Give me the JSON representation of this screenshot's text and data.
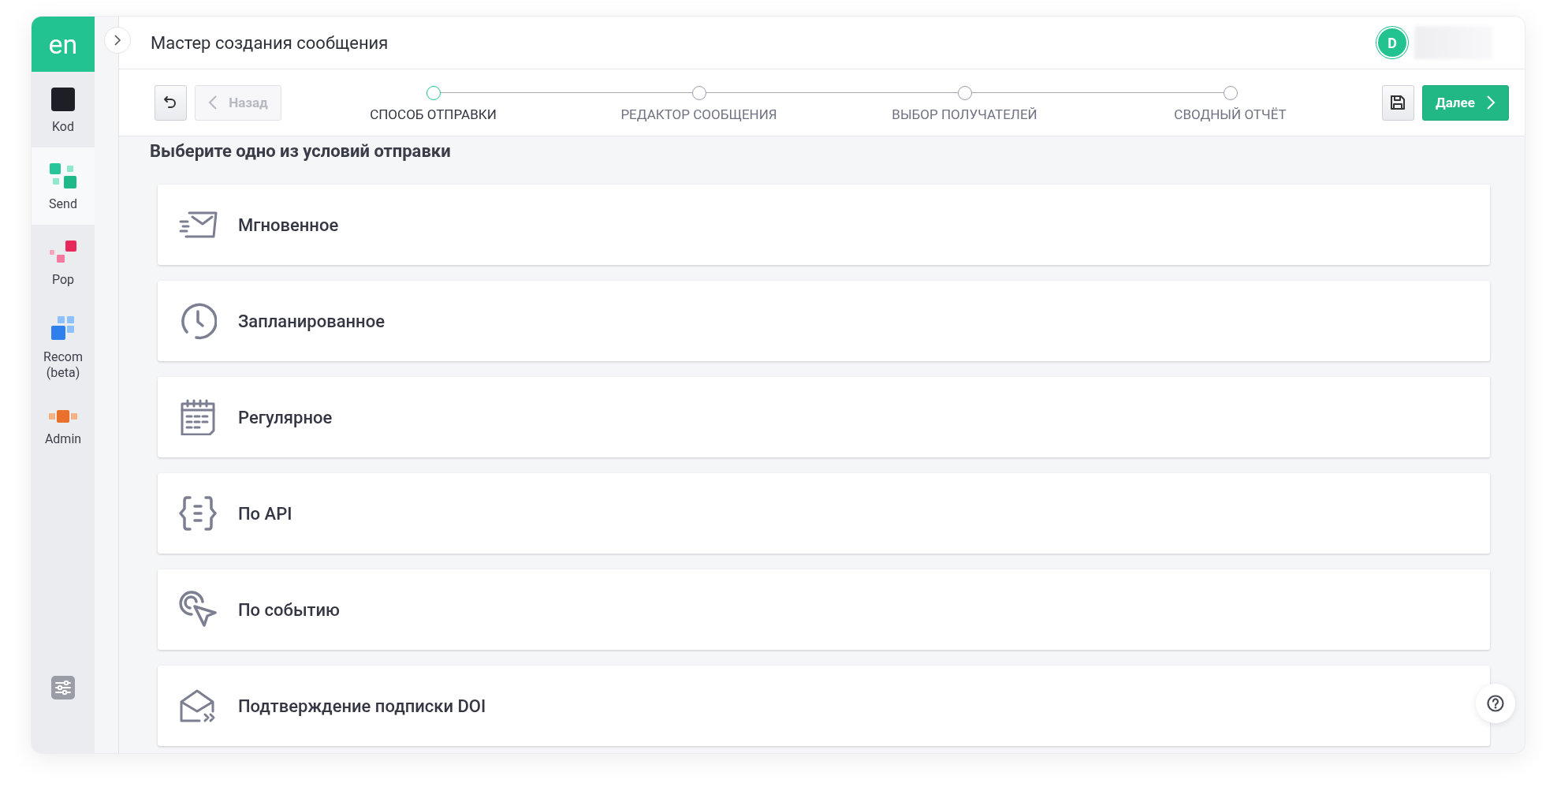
{
  "logo": "en",
  "sidebar": {
    "items": [
      {
        "label": "Kod",
        "kind": "kod",
        "selected": false
      },
      {
        "label": "Send",
        "kind": "send",
        "selected": true
      },
      {
        "label": "Pop",
        "kind": "pop",
        "selected": false
      },
      {
        "label": "Recom (beta)",
        "kind": "recom",
        "selected": false
      },
      {
        "label": "Admin",
        "kind": "admin",
        "selected": false
      }
    ]
  },
  "header": {
    "title": "Мастер создания сообщения",
    "avatar": "D"
  },
  "toolbar": {
    "back": {
      "label": "Назад",
      "disabled": true
    },
    "next": {
      "label": "Далее",
      "disabled": false
    }
  },
  "steps": [
    {
      "label": "СПОСОБ ОТПРАВКИ",
      "selected": true
    },
    {
      "label": "РЕДАКТОР СООБЩЕНИЯ",
      "selected": false
    },
    {
      "label": "ВЫБОР ПОЛУЧАТЕЛЕЙ",
      "selected": false
    },
    {
      "label": "СВОДНЫЙ ОТЧЁТ",
      "selected": false
    }
  ],
  "heading": "Выберите одно из условий отправки",
  "options": [
    {
      "label": "Мгновенное",
      "kind": "instant"
    },
    {
      "label": "Запланированное",
      "kind": "scheduled"
    },
    {
      "label": "Регулярное",
      "kind": "regular"
    },
    {
      "label": "По API",
      "kind": "api"
    },
    {
      "label": "По событию",
      "kind": "event"
    },
    {
      "label": "Подтверждение подписки DOI",
      "kind": "doi"
    }
  ]
}
